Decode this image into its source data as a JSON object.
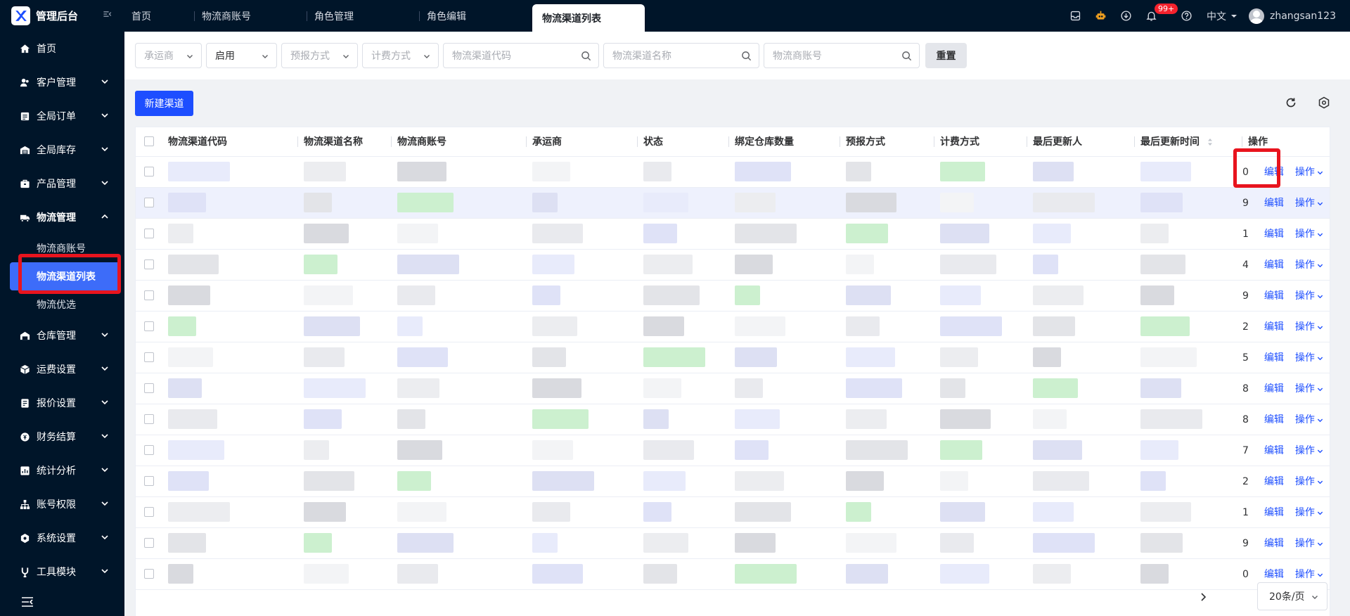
{
  "app": {
    "title": "管理后台",
    "collapse_icon": "collapse-icon",
    "brand_color": "#1d4eff",
    "sidebar_bg": "#001529",
    "highlight_color": "#e8141e"
  },
  "tabs": [
    {
      "label": "首页"
    },
    {
      "label": "物流商账号"
    },
    {
      "label": "角色管理"
    },
    {
      "label": "角色编辑"
    },
    {
      "label": "物流渠道列表",
      "active": true
    }
  ],
  "header": {
    "notification_badge": "99+",
    "language": "中文",
    "username": "zhangsan123"
  },
  "sidebar": {
    "items": [
      {
        "label": "首页",
        "icon": "home-icon"
      },
      {
        "label": "客户管理",
        "icon": "customer-icon"
      },
      {
        "label": "全局订单",
        "icon": "order-icon"
      },
      {
        "label": "全局库存",
        "icon": "inventory-icon"
      },
      {
        "label": "产品管理",
        "icon": "product-icon"
      },
      {
        "label": "物流管理",
        "icon": "truck-icon",
        "expanded": true,
        "children": [
          {
            "label": "物流商账号"
          },
          {
            "label": "物流渠道列表",
            "active": true
          },
          {
            "label": "物流优选"
          }
        ]
      },
      {
        "label": "仓库管理",
        "icon": "warehouse-icon"
      },
      {
        "label": "运费设置",
        "icon": "freight-icon"
      },
      {
        "label": "报价设置",
        "icon": "quote-icon"
      },
      {
        "label": "财务结算",
        "icon": "finance-icon"
      },
      {
        "label": "统计分析",
        "icon": "stats-icon"
      },
      {
        "label": "账号权限",
        "icon": "permission-icon"
      },
      {
        "label": "系统设置",
        "icon": "settings-icon"
      },
      {
        "label": "工具模块",
        "icon": "tools-icon"
      }
    ]
  },
  "filters": {
    "carrier_placeholder": "承运商",
    "status_value": "启用",
    "forecast_placeholder": "预报方式",
    "billing_placeholder": "计费方式",
    "channel_code_placeholder": "物流渠道代码",
    "channel_name_placeholder": "物流渠道名称",
    "account_placeholder": "物流商账号",
    "reset_label": "重置"
  },
  "toolbar": {
    "new_channel_label": "新建渠道"
  },
  "table": {
    "columns": [
      "物流渠道代码",
      "物流渠道名称",
      "物流商账号",
      "承运商",
      "状态",
      "绑定仓库数量",
      "预报方式",
      "计费方式",
      "最后更新人",
      "最后更新时间",
      "操作"
    ],
    "edit_label": "编辑",
    "more_label": "操作",
    "row_suffixes": [
      "0",
      "9",
      "1",
      "4",
      "9",
      "2",
      "5",
      "8",
      "8",
      "7",
      "2",
      "1",
      "9",
      "0"
    ]
  },
  "pagination": {
    "page_size_label": "20条/页"
  }
}
